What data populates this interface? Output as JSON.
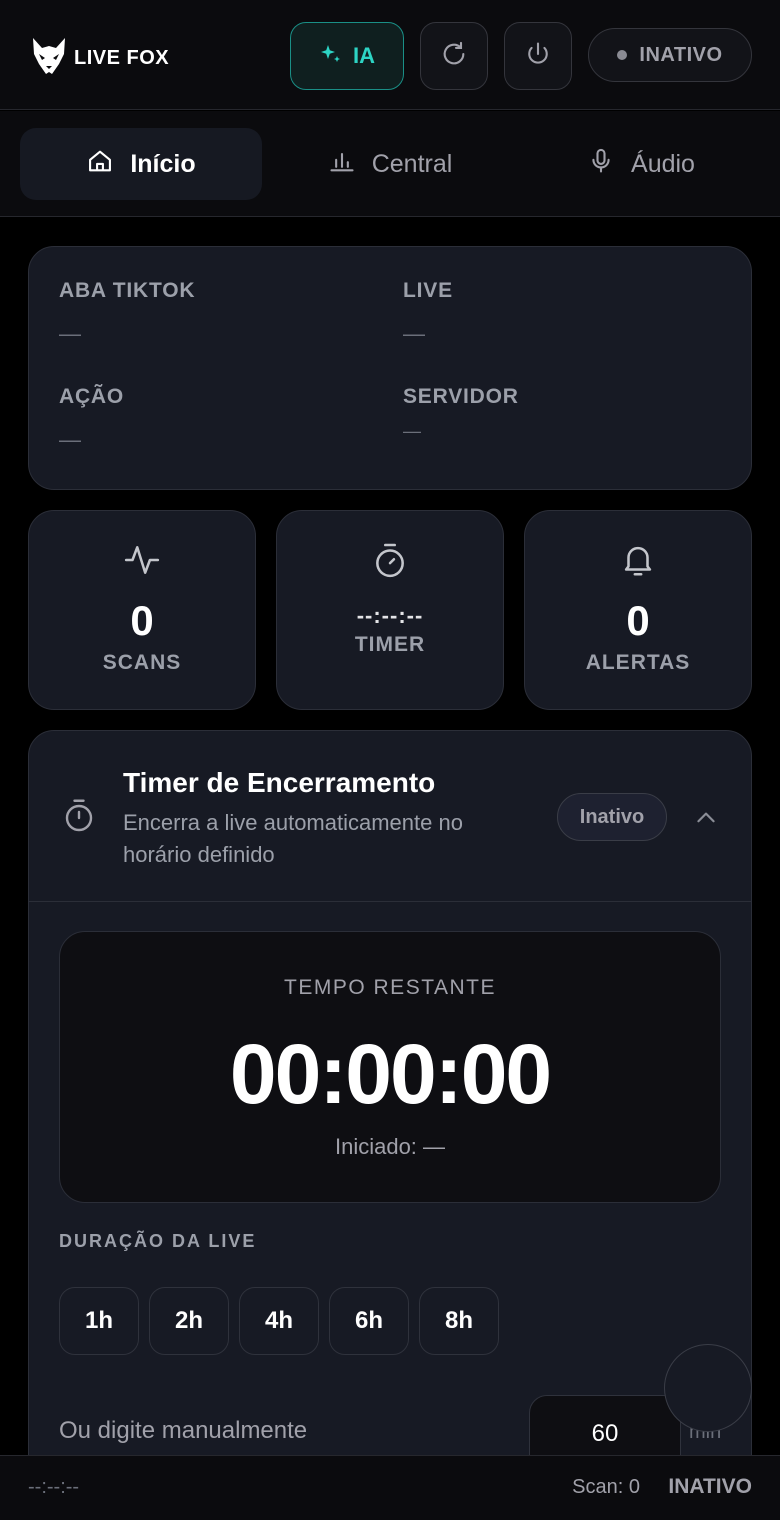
{
  "header": {
    "brand": "LIVE FOX",
    "ia_label": "IA",
    "status": "INATIVO",
    "accent_color": "#2dd4c4"
  },
  "nav": {
    "tabs": [
      {
        "label": "Início",
        "icon": "home-icon",
        "active": true
      },
      {
        "label": "Central",
        "icon": "bar-chart-icon",
        "active": false
      },
      {
        "label": "Áudio",
        "icon": "microphone-icon",
        "active": false
      }
    ]
  },
  "info": {
    "aba_tiktok": {
      "label": "ABA TIKTOK",
      "value": "—"
    },
    "live": {
      "label": "LIVE",
      "value": "—"
    },
    "acao": {
      "label": "AÇÃO",
      "value": "—"
    },
    "servidor": {
      "label": "SERVIDOR",
      "value": "—"
    }
  },
  "stats": {
    "scans": {
      "value": "0",
      "label": "SCANS",
      "icon": "activity-icon"
    },
    "timer": {
      "value": "--:--:--",
      "label": "TIMER",
      "icon": "stopwatch-icon"
    },
    "alerts": {
      "value": "0",
      "label": "ALERTAS",
      "icon": "bell-icon"
    }
  },
  "timer_card": {
    "title": "Timer de Encerramento",
    "subtitle": "Encerra a live automaticamente no horário definido",
    "badge": "Inativo",
    "remaining_label": "TEMPO RESTANTE",
    "remaining_time": "00:00:00",
    "started": "Iniciado: —",
    "duration_label": "DURAÇÃO DA LIVE",
    "presets": [
      "1h",
      "2h",
      "4h",
      "6h",
      "8h"
    ],
    "manual_label": "Ou digite manualmente",
    "manual_value": "60",
    "unit": "min"
  },
  "footer": {
    "time": "--:--:--",
    "scan": "Scan: 0",
    "status": "INATIVO"
  }
}
